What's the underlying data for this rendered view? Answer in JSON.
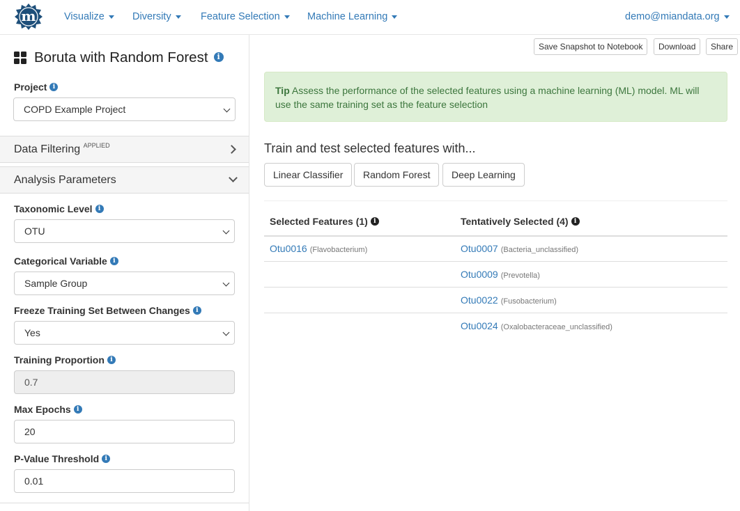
{
  "nav": {
    "items": [
      {
        "label": "Visualize"
      },
      {
        "label": "Diversity"
      },
      {
        "label": "Feature Selection"
      },
      {
        "label": "Machine Learning"
      }
    ],
    "user": "demo@miandata.org"
  },
  "sidebar": {
    "title": "Boruta with Random Forest",
    "project_label": "Project",
    "project_value": "COPD Example Project",
    "data_filtering": {
      "label": "Data Filtering",
      "badge": "APPLIED"
    },
    "analysis_parameters": {
      "label": "Analysis Parameters"
    },
    "fields": [
      {
        "label": "Taxonomic Level",
        "value": "OTU"
      },
      {
        "label": "Categorical Variable",
        "value": "Sample Group"
      },
      {
        "label": "Freeze Training Set Between Changes",
        "value": "Yes"
      },
      {
        "label": "Training Proportion",
        "value": "0.7"
      },
      {
        "label": "Max Epochs",
        "value": "20"
      },
      {
        "label": "P-Value Threshold",
        "value": "0.01"
      }
    ]
  },
  "toolbar": {
    "snapshot": "Save Snapshot to Notebook",
    "download": "Download",
    "share": "Share"
  },
  "tip": {
    "label": "Tip",
    "text": "Assess the performance of the selected features using a machine learning (ML) model. ML will use the same training set as the feature selection"
  },
  "train": {
    "heading": "Train and test selected features with...",
    "buttons": [
      "Linear Classifier",
      "Random Forest",
      "Deep Learning"
    ]
  },
  "table": {
    "selected_header": "Selected Features (1)",
    "tentative_header": "Tentatively Selected (4)",
    "selected": [
      {
        "id": "Otu0016",
        "taxon": "(Flavobacterium)"
      }
    ],
    "tentative": [
      {
        "id": "Otu0007",
        "taxon": "(Bacteria_unclassified)"
      },
      {
        "id": "Otu0009",
        "taxon": "(Prevotella)"
      },
      {
        "id": "Otu0022",
        "taxon": "(Fusobacterium)"
      },
      {
        "id": "Otu0024",
        "taxon": "(Oxalobacteraceae_unclassified)"
      }
    ]
  },
  "colors": {
    "link": "#337ab7",
    "tip_bg": "#dff0d8",
    "tip_text": "#3c763d",
    "logo": "#1e4f7a"
  },
  "icons": [
    "logo-icon",
    "grid-icon",
    "info-icon",
    "caret-down-icon",
    "chevron-right-icon",
    "chevron-down-icon"
  ]
}
